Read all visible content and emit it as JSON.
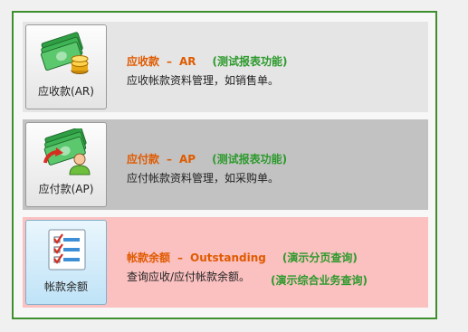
{
  "modules": [
    {
      "button_label": "应收款(AR)",
      "name": "应收款",
      "dash": "–",
      "code": "AR",
      "note": "(测试报表功能)",
      "description": "应收帐款资料管理，如销售单。",
      "icon": "money-coins-icon",
      "bg_color": "#e5e5e5"
    },
    {
      "button_label": "应付款(AP)",
      "name": "应付款",
      "dash": "–",
      "code": "AP",
      "note": "(测试报表功能)",
      "description": "应付帐款资料管理，如采购单。",
      "icon": "money-person-icon",
      "bg_color": "#c2c2c2"
    },
    {
      "button_label": "帐款余额",
      "name": "帐款余额",
      "dash": "–",
      "code": "Outstanding",
      "note": "(演示分页查询)",
      "description": "查询应收/应付帐款余额。",
      "note2": "(演示综合业务查询)",
      "icon": "checklist-icon",
      "bg_color": "#fbc0c0"
    }
  ],
  "colors": {
    "title": "#e05a00",
    "note": "#2d9a2d",
    "frame_border": "#3f8f2f"
  }
}
